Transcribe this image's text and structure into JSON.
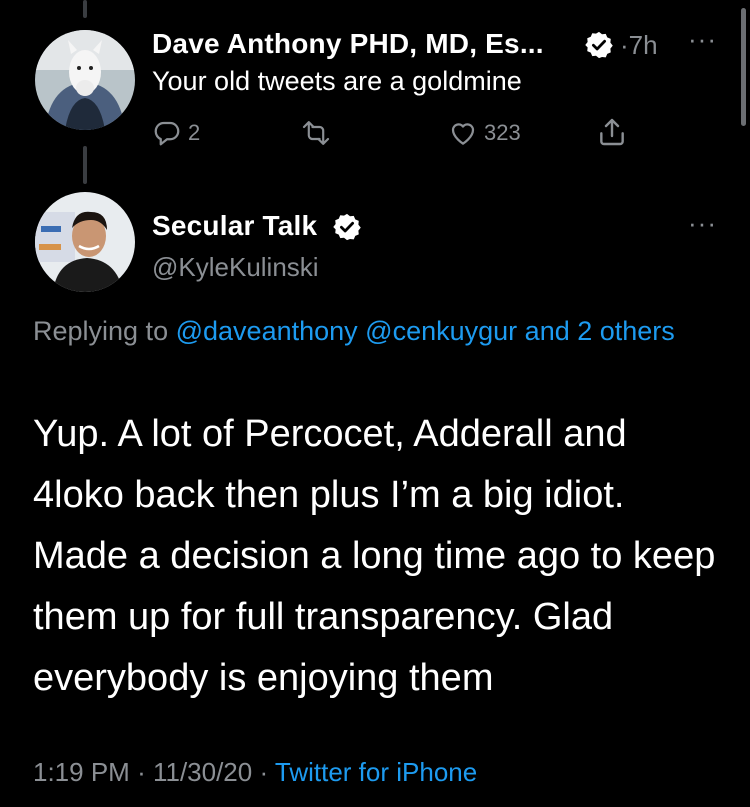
{
  "tweet_parent": {
    "display_name": "Dave Anthony PHD, MD, Es...",
    "time": "7h",
    "text": "Your old tweets are a goldmine",
    "replies": "2",
    "likes": "323",
    "more_label": "···"
  },
  "tweet_main": {
    "display_name": "Secular Talk",
    "handle": "@KyleKulinski",
    "more_label": "···",
    "replying_to_label": "Replying to",
    "mention_1": "@daveanthony",
    "mention_2": "@cenkuygur",
    "others": "and 2 others",
    "text": "Yup. A lot of Percocet, Adderall and 4loko back then plus I’m a big idiot. Made a decision a long time ago to keep them up for full transparency. Glad everybody is enjoying them",
    "time": "1:19 PM",
    "date": "11/30/20",
    "source": "Twitter for iPhone"
  },
  "colors": {
    "background": "#000000",
    "text": "#ffffff",
    "muted": "#8b8f94",
    "link": "#1d9bf0"
  },
  "icons": [
    "verified-badge-icon",
    "reply-icon",
    "retweet-icon",
    "like-icon",
    "share-icon",
    "more-icon"
  ]
}
